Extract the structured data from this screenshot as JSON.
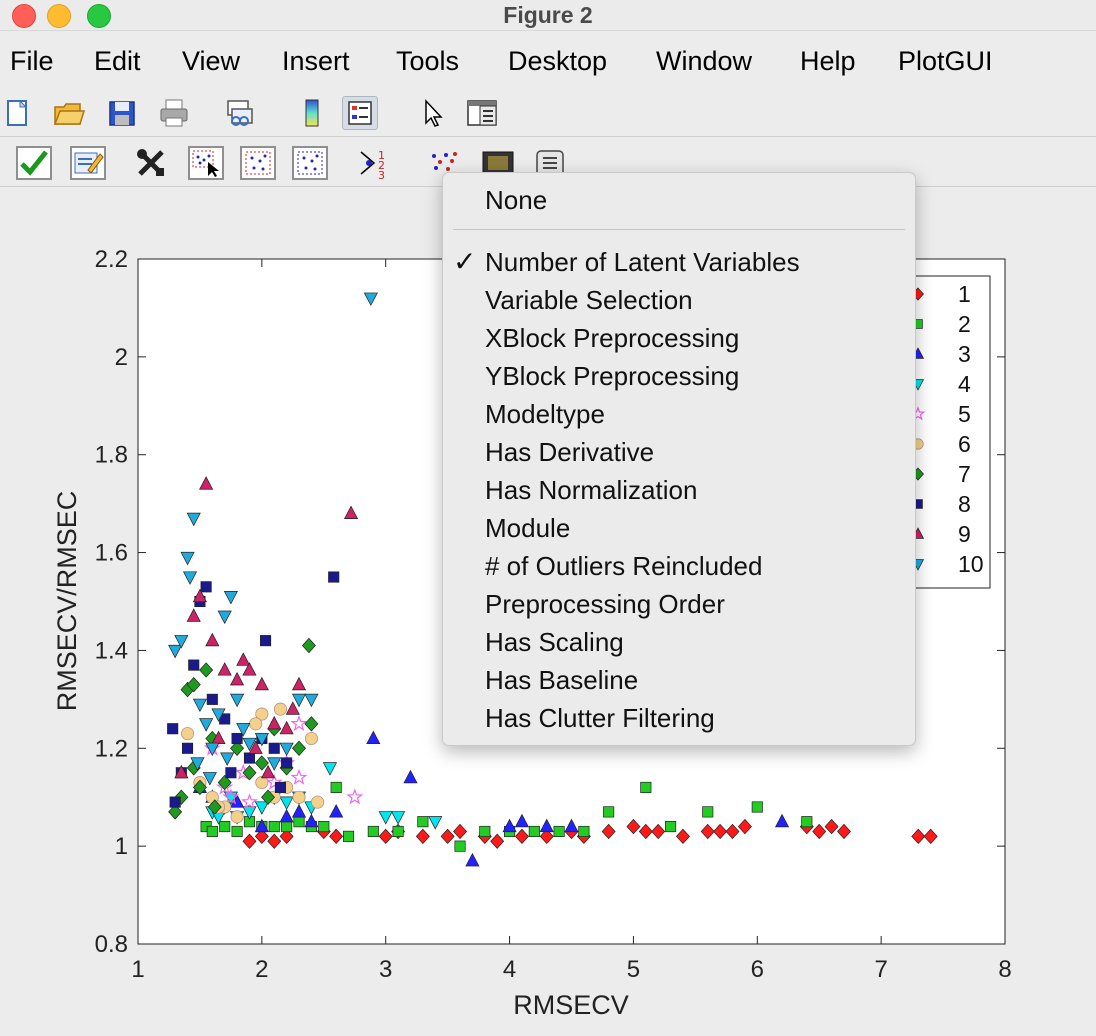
{
  "window": {
    "title": "Figure 2"
  },
  "menu": [
    "File",
    "Edit",
    "View",
    "Insert",
    "Tools",
    "Desktop",
    "Window",
    "Help",
    "PlotGUI"
  ],
  "toolbar1": [
    "new-icon",
    "open-icon",
    "save-icon",
    "print-icon",
    "link-icon",
    "colorbar-icon",
    "legend-icon",
    "pointer-icon",
    "propeditor-icon"
  ],
  "toolbar2": [
    "accept-icon",
    "edit-icon",
    "tools-icon",
    "select-points-icon",
    "select-region-icon",
    "deselect-icon",
    "numbering-icon",
    "class-icon",
    "swatch-icon",
    "list-icon"
  ],
  "dropdown": {
    "items": [
      "None",
      "Number of Latent Variables",
      "Variable Selection",
      "XBlock Preprocessing",
      "YBlock Preprocessing",
      "Modeltype",
      "Has Derivative",
      "Has Normalization",
      "Module",
      "# of Outliers Reincluded",
      "Preprocessing Order",
      "Has Scaling",
      "Has Baseline",
      "Has Clutter Filtering"
    ],
    "checked_item": "Number of Latent Variables",
    "check_mark": "✓"
  },
  "chart_data": {
    "type": "scatter",
    "xlabel": "RMSECV",
    "ylabel": "RMSECV/RMSEC",
    "xlim": [
      1,
      8
    ],
    "ylim": [
      0.8,
      2.2
    ],
    "xticks": [
      "1",
      "2",
      "3",
      "4",
      "5",
      "6",
      "7",
      "8"
    ],
    "yticks": [
      "0.8",
      "1",
      "1.2",
      "1.4",
      "1.6",
      "1.8",
      "2",
      "2.2"
    ],
    "legend_position": "top-right",
    "series": [
      {
        "name": "1",
        "marker": "diamond",
        "color": "#ff1a1a",
        "points": [
          [
            1.9,
            1.01
          ],
          [
            2.0,
            1.02
          ],
          [
            2.1,
            1.01
          ],
          [
            2.2,
            1.02
          ],
          [
            2.5,
            1.03
          ],
          [
            2.6,
            1.02
          ],
          [
            3.0,
            1.02
          ],
          [
            3.1,
            1.03
          ],
          [
            3.3,
            1.02
          ],
          [
            3.5,
            1.02
          ],
          [
            3.6,
            1.03
          ],
          [
            3.8,
            1.02
          ],
          [
            3.9,
            1.01
          ],
          [
            4.1,
            1.02
          ],
          [
            4.3,
            1.02
          ],
          [
            4.5,
            1.03
          ],
          [
            4.6,
            1.02
          ],
          [
            4.8,
            1.03
          ],
          [
            5.0,
            1.04
          ],
          [
            5.1,
            1.03
          ],
          [
            5.2,
            1.03
          ],
          [
            5.4,
            1.02
          ],
          [
            5.6,
            1.03
          ],
          [
            5.7,
            1.03
          ],
          [
            5.8,
            1.03
          ],
          [
            5.9,
            1.04
          ],
          [
            6.4,
            1.04
          ],
          [
            6.5,
            1.03
          ],
          [
            6.6,
            1.04
          ],
          [
            6.7,
            1.03
          ],
          [
            7.3,
            1.02
          ],
          [
            7.4,
            1.02
          ]
        ]
      },
      {
        "name": "2",
        "marker": "square",
        "color": "#22cc22",
        "points": [
          [
            1.55,
            1.04
          ],
          [
            1.6,
            1.03
          ],
          [
            1.7,
            1.04
          ],
          [
            1.8,
            1.03
          ],
          [
            2.0,
            1.04
          ],
          [
            2.1,
            1.04
          ],
          [
            2.2,
            1.04
          ],
          [
            2.4,
            1.04
          ],
          [
            2.5,
            1.04
          ],
          [
            2.6,
            1.12
          ],
          [
            2.7,
            1.02
          ],
          [
            2.9,
            1.03
          ],
          [
            3.1,
            1.03
          ],
          [
            3.3,
            1.05
          ],
          [
            3.6,
            1.0
          ],
          [
            3.8,
            1.03
          ],
          [
            4.0,
            1.03
          ],
          [
            4.2,
            1.03
          ],
          [
            4.4,
            1.03
          ],
          [
            4.6,
            1.03
          ],
          [
            4.8,
            1.07
          ],
          [
            5.1,
            1.12
          ],
          [
            5.3,
            1.04
          ],
          [
            5.6,
            1.07
          ],
          [
            6.0,
            1.08
          ],
          [
            6.4,
            1.05
          ],
          [
            2.3,
            1.05
          ],
          [
            1.9,
            1.05
          ]
        ]
      },
      {
        "name": "3",
        "marker": "triangle-up",
        "color": "#2222ff",
        "points": [
          [
            1.5,
            1.12
          ],
          [
            1.6,
            1.1
          ],
          [
            2.0,
            1.04
          ],
          [
            2.2,
            1.06
          ],
          [
            2.4,
            1.05
          ],
          [
            2.6,
            1.07
          ],
          [
            2.9,
            1.22
          ],
          [
            3.2,
            1.14
          ],
          [
            3.7,
            0.97
          ],
          [
            4.0,
            1.04
          ],
          [
            4.1,
            1.05
          ],
          [
            4.3,
            1.04
          ],
          [
            4.5,
            1.04
          ],
          [
            6.2,
            1.05
          ],
          [
            1.8,
            1.09
          ],
          [
            2.3,
            1.07
          ]
        ]
      },
      {
        "name": "4",
        "marker": "triangle-down",
        "color": "#00e5ee",
        "points": [
          [
            1.6,
            1.07
          ],
          [
            1.7,
            1.08
          ],
          [
            1.8,
            1.06
          ],
          [
            1.9,
            1.07
          ],
          [
            2.0,
            1.08
          ],
          [
            2.1,
            1.1
          ],
          [
            2.2,
            1.09
          ],
          [
            2.3,
            1.1
          ],
          [
            2.4,
            1.08
          ],
          [
            2.55,
            1.16
          ],
          [
            3.0,
            1.06
          ],
          [
            3.1,
            1.06
          ],
          [
            3.4,
            1.05
          ],
          [
            1.75,
            1.1
          ],
          [
            1.65,
            1.06
          ]
        ]
      },
      {
        "name": "5",
        "marker": "star",
        "color": "#ee66ee",
        "points": [
          [
            1.6,
            1.2
          ],
          [
            1.7,
            1.12
          ],
          [
            1.9,
            1.09
          ],
          [
            2.1,
            1.13
          ],
          [
            2.3,
            1.25
          ],
          [
            2.3,
            1.14
          ],
          [
            2.75,
            1.1
          ],
          [
            2.2,
            1.17
          ],
          [
            1.85,
            1.15
          ],
          [
            1.75,
            1.1
          ]
        ]
      },
      {
        "name": "6",
        "marker": "circle",
        "color": "#f3d18a",
        "points": [
          [
            1.4,
            1.23
          ],
          [
            1.5,
            1.13
          ],
          [
            1.6,
            1.1
          ],
          [
            1.7,
            1.08
          ],
          [
            1.8,
            1.06
          ],
          [
            2.0,
            1.27
          ],
          [
            2.0,
            1.13
          ],
          [
            2.1,
            1.1
          ],
          [
            2.2,
            1.12
          ],
          [
            2.3,
            1.1
          ],
          [
            2.4,
            1.22
          ],
          [
            2.45,
            1.09
          ],
          [
            1.95,
            1.25
          ],
          [
            1.65,
            1.08
          ],
          [
            2.15,
            1.28
          ]
        ]
      },
      {
        "name": "7",
        "marker": "diamond",
        "color": "#1f9a1f",
        "points": [
          [
            1.3,
            1.07
          ],
          [
            1.35,
            1.1
          ],
          [
            1.4,
            1.32
          ],
          [
            1.45,
            1.16
          ],
          [
            1.5,
            1.12
          ],
          [
            1.55,
            1.36
          ],
          [
            1.6,
            1.22
          ],
          [
            1.7,
            1.13
          ],
          [
            1.8,
            1.2
          ],
          [
            1.9,
            1.15
          ],
          [
            2.0,
            1.17
          ],
          [
            2.1,
            1.24
          ],
          [
            2.2,
            1.16
          ],
          [
            2.3,
            1.2
          ],
          [
            2.4,
            1.25
          ],
          [
            2.38,
            1.41
          ],
          [
            1.45,
            1.33
          ],
          [
            1.62,
            1.08
          ],
          [
            2.05,
            1.1
          ]
        ]
      },
      {
        "name": "8",
        "marker": "square",
        "color": "#1a1a8c",
        "points": [
          [
            1.28,
            1.24
          ],
          [
            1.3,
            1.09
          ],
          [
            1.35,
            1.15
          ],
          [
            1.4,
            1.2
          ],
          [
            1.45,
            1.37
          ],
          [
            1.5,
            1.5
          ],
          [
            1.55,
            1.53
          ],
          [
            1.6,
            1.3
          ],
          [
            1.7,
            1.26
          ],
          [
            1.8,
            1.22
          ],
          [
            1.9,
            1.18
          ],
          [
            2.0,
            1.22
          ],
          [
            2.03,
            1.42
          ],
          [
            2.1,
            1.2
          ],
          [
            2.2,
            1.17
          ],
          [
            2.58,
            1.55
          ],
          [
            1.75,
            1.15
          ],
          [
            2.15,
            1.12
          ]
        ]
      },
      {
        "name": "9",
        "marker": "triangle-up",
        "color": "#cc2266",
        "points": [
          [
            1.35,
            1.15
          ],
          [
            1.45,
            1.47
          ],
          [
            1.5,
            1.51
          ],
          [
            1.55,
            1.74
          ],
          [
            1.6,
            1.42
          ],
          [
            1.7,
            1.36
          ],
          [
            1.8,
            1.34
          ],
          [
            1.85,
            1.38
          ],
          [
            1.9,
            1.36
          ],
          [
            2.0,
            1.33
          ],
          [
            2.05,
            1.15
          ],
          [
            2.1,
            1.25
          ],
          [
            2.2,
            1.24
          ],
          [
            2.3,
            1.33
          ],
          [
            2.72,
            1.68
          ],
          [
            1.95,
            1.2
          ],
          [
            2.25,
            1.28
          ],
          [
            1.65,
            1.22
          ]
        ]
      },
      {
        "name": "10",
        "marker": "triangle-down",
        "color": "#22aadd",
        "points": [
          [
            1.3,
            1.4
          ],
          [
            1.35,
            1.42
          ],
          [
            1.4,
            1.59
          ],
          [
            1.42,
            1.55
          ],
          [
            1.45,
            1.67
          ],
          [
            1.5,
            1.29
          ],
          [
            1.55,
            1.25
          ],
          [
            1.6,
            1.2
          ],
          [
            1.7,
            1.47
          ],
          [
            1.75,
            1.51
          ],
          [
            1.8,
            1.3
          ],
          [
            1.85,
            1.24
          ],
          [
            1.9,
            1.21
          ],
          [
            2.0,
            1.22
          ],
          [
            2.1,
            1.17
          ],
          [
            2.2,
            1.2
          ],
          [
            2.3,
            1.3
          ],
          [
            2.4,
            1.3
          ],
          [
            2.88,
            2.12
          ],
          [
            1.65,
            1.27
          ],
          [
            1.72,
            1.18
          ],
          [
            1.58,
            1.14
          ],
          [
            1.48,
            1.17
          ]
        ]
      }
    ]
  }
}
